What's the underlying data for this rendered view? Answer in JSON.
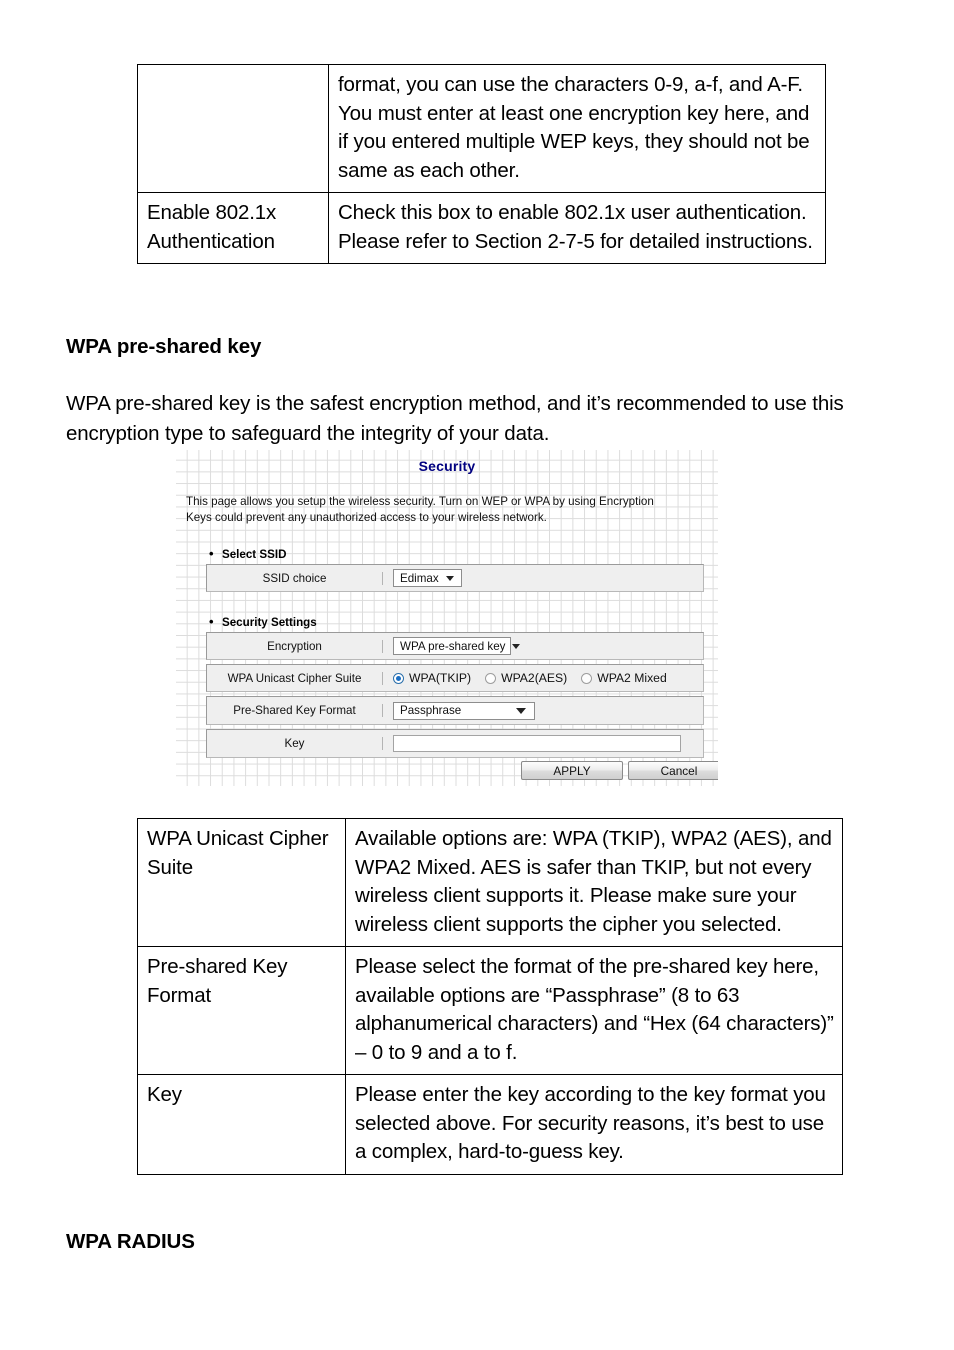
{
  "document": {
    "top_table": {
      "rows": [
        {
          "label": "",
          "description": "format, you can use the characters 0-9, a-f, and A-F. You must enter at least one encryption key here, and if you entered multiple WEP keys, they should not be same as each other."
        },
        {
          "label": "Enable 802.1x Authentication",
          "description": "Check this box to enable 802.1x user authentication. Please refer to Section 2-7-5 for detailed instructions."
        }
      ]
    },
    "heading_wpa_psk": "WPA pre-shared key",
    "paragraph_intro": "WPA pre-shared key is the safest encryption method, and it’s recommended to use this encryption type to safeguard the integrity of your data.",
    "heading_wpa_radius": "WPA RADIUS",
    "bottom_table": {
      "rows": [
        {
          "label": "WPA Unicast Cipher Suite",
          "description": "Available options are: WPA (TKIP), WPA2 (AES), and WPA2 Mixed. AES is safer than TKIP, but not every wireless client supports it. Please make sure your wireless client supports the cipher you selected."
        },
        {
          "label": "Pre-shared Key Format",
          "description": "Please select the format of the pre-shared key here, available options are “Passphrase” (8 to 63 alphanumerical characters) and “Hex (64 characters)” – 0 to 9 and a to f."
        },
        {
          "label": "Key",
          "description": "Please enter the key according to the key format you selected above. For security reasons, it’s best to use a complex, hard-to-guess key."
        }
      ]
    }
  },
  "router_screenshot": {
    "title": "Security",
    "title_color": "#000080",
    "description": "This page allows you setup the wireless security. Turn on WEP or WPA by using Encryption Keys could prevent any unauthorized access to your wireless network.",
    "sections": [
      {
        "name": "select-ssid",
        "heading": "Select SSID"
      },
      {
        "name": "security-settings",
        "heading": "Security Settings"
      }
    ],
    "fields": {
      "ssid_choice": {
        "label": "SSID choice",
        "value": "Edimax",
        "control": "dropdown"
      },
      "encryption": {
        "label": "Encryption",
        "value": "WPA pre-shared key",
        "control": "dropdown"
      },
      "cipher_suite": {
        "label": "WPA Unicast Cipher Suite",
        "control": "radio-group",
        "options": [
          {
            "label": "WPA(TKIP)",
            "selected": true
          },
          {
            "label": "WPA2(AES)",
            "selected": false
          },
          {
            "label": "WPA2 Mixed",
            "selected": false
          }
        ]
      },
      "key_format": {
        "label": "Pre-Shared Key Format",
        "value": "Passphrase",
        "control": "dropdown"
      },
      "key": {
        "label": "Key",
        "value": "",
        "control": "text-input"
      }
    },
    "buttons": {
      "apply": "APPLY",
      "cancel": "Cancel"
    }
  }
}
